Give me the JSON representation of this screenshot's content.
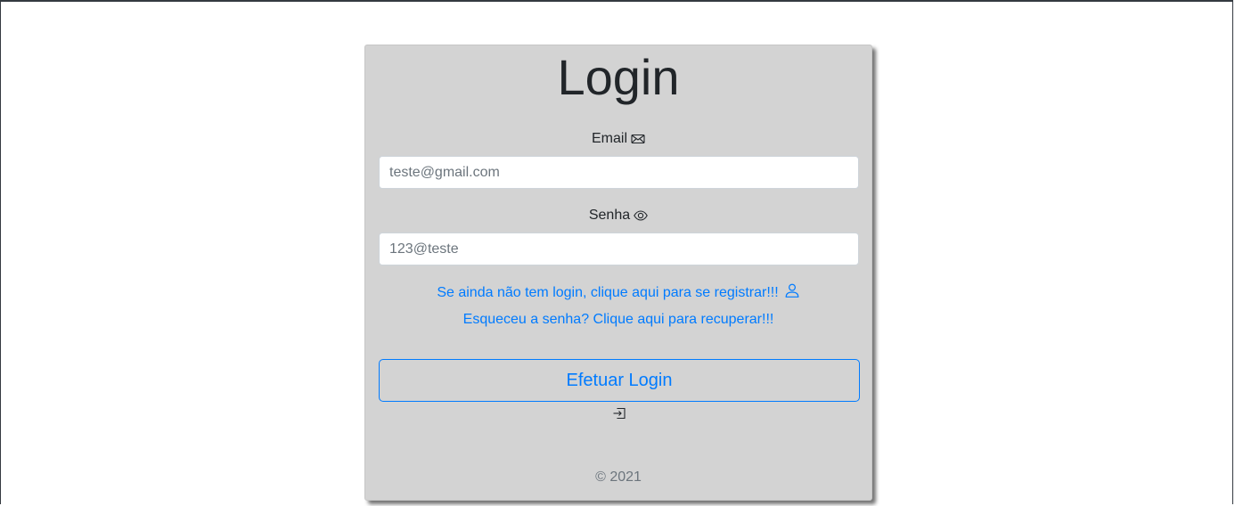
{
  "form": {
    "title": "Login",
    "email_label": "Email",
    "email_placeholder": "teste@gmail.com",
    "password_label": "Senha",
    "password_placeholder": "123@teste",
    "register_link": "Se ainda não tem login, clique aqui para se registrar!!!",
    "forgot_link": "Esqueceu a senha? Clique aqui para recuperar!!!",
    "submit_label": "Efetuar Login",
    "footer": "© 2021"
  },
  "icons": {
    "email": "envelope-icon",
    "password": "eye-icon",
    "register": "person-icon",
    "submit": "box-arrow-in-right-icon"
  },
  "colors": {
    "card_background": "#d3d3d3",
    "link": "#007bff",
    "text": "#212529",
    "muted": "#6c757d"
  }
}
